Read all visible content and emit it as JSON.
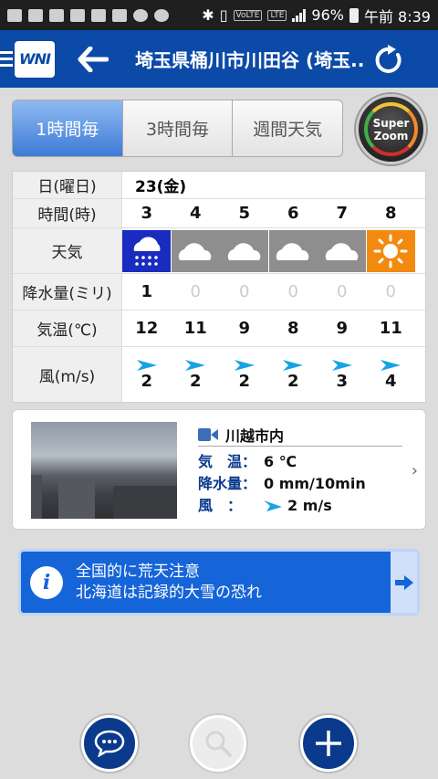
{
  "status_bar": {
    "battery": "96%",
    "time": "午前 8:39",
    "network": "LTE",
    "volte": "VoLTE"
  },
  "header": {
    "title": "埼玉県桶川市川田谷 (埼玉...",
    "logo_text": "WNI"
  },
  "tabs": [
    {
      "label": "1時間毎",
      "active": true
    },
    {
      "label": "3時間毎",
      "active": false
    },
    {
      "label": "週間天気",
      "active": false
    }
  ],
  "superzoom": {
    "label_line1": "Super",
    "label_line2": "Zoom"
  },
  "forecast": {
    "labels": {
      "date": "日(曜日)",
      "time": "時間(時)",
      "weather": "天気",
      "precip": "降水量(ミリ)",
      "temp": "気温(℃)",
      "wind": "風(m/s)"
    },
    "date": "23(金)",
    "hours": [
      {
        "hour": "3",
        "weather": "rain-icon",
        "precip": "1",
        "temp": "12",
        "wind": "2"
      },
      {
        "hour": "4",
        "weather": "cloud-icon",
        "precip": "0",
        "temp": "11",
        "wind": "2"
      },
      {
        "hour": "5",
        "weather": "cloud-icon",
        "precip": "0",
        "temp": "9",
        "wind": "2"
      },
      {
        "hour": "6",
        "weather": "cloud-icon",
        "precip": "0",
        "temp": "8",
        "wind": "2"
      },
      {
        "hour": "7",
        "weather": "cloud-icon",
        "precip": "0",
        "temp": "9",
        "wind": "3"
      },
      {
        "hour": "8",
        "weather": "sun-icon",
        "precip": "0",
        "temp": "11",
        "wind": "4"
      }
    ]
  },
  "camera": {
    "title": "川越市内",
    "temp_label": "気　温：",
    "temp_value": "6 ℃",
    "rain_label": "降水量：",
    "rain_value": "0 mm/10min",
    "wind_label": "風　：",
    "wind_value": "2 m/s"
  },
  "alert": {
    "line1": "全国的に荒天注意",
    "line2": "北海道は記録的大雪の恐れ"
  },
  "colors": {
    "brand_blue": "#0b4aa6",
    "tab_active": "#3d7bd6",
    "alert_blue": "#1564d8",
    "rain_bg": "#1a2bbf",
    "cloud_bg": "#8e8e8e",
    "sun_bg": "#f28a10"
  }
}
